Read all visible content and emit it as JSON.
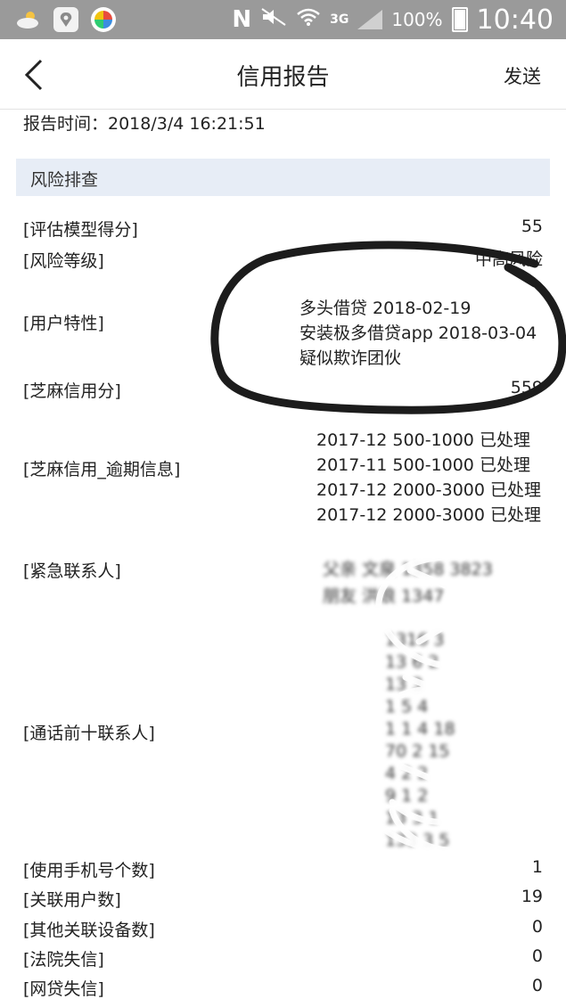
{
  "status_bar": {
    "network": "3G",
    "battery": "100%",
    "time": "10:40"
  },
  "nav": {
    "title": "信用报告",
    "send_label": "发送"
  },
  "report_time": "报告时间：2018/3/4 16:21:51",
  "section": {
    "title": "风险排查"
  },
  "rows": {
    "model_score": {
      "label": "[评估模型得分]",
      "value": "55"
    },
    "risk_level": {
      "label": "[风险等级]",
      "value": "中高风险"
    },
    "user_traits": {
      "label": "[用户特性]",
      "lines": [
        "多头借贷 2018-02-19",
        "安装极多借贷app 2018-03-04",
        "疑似欺诈团伙"
      ]
    },
    "sesame_score": {
      "label": "[芝麻信用分]",
      "value": "559"
    },
    "sesame_overdue": {
      "label": "[芝麻信用_逾期信息]",
      "lines": [
        "2017-12 500-1000 已处理",
        "2017-11 500-1000 已处理",
        "2017-12 2000-3000 已处理",
        "2017-12 2000-3000 已处理"
      ]
    },
    "emergency_contacts": {
      "label": "[紧急联系人]",
      "lines": [
        "父亲 文泉 1358 3823",
        "朋友 洪浪 1347"
      ]
    },
    "top_contacts": {
      "label": "[通话前十联系人]",
      "lines": [
        "1316 3",
        "13 6 2",
        "13 3",
        "1 5 4",
        "1 1 4 18",
        "70 2 15",
        "4 2 2",
        "9 1 2",
        "13 3 1",
        "133 3 5"
      ]
    },
    "phone_count": {
      "label": "[使用手机号个数]",
      "value": "1"
    },
    "linked_users": {
      "label": "[关联用户数]",
      "value": "19"
    },
    "other_devices": {
      "label": "[其他关联设备数]",
      "value": "0"
    },
    "court_dishonest": {
      "label": "[法院失信]",
      "value": "0"
    },
    "p2p_dishonest": {
      "label": "[网贷失信]",
      "value": "0"
    }
  }
}
